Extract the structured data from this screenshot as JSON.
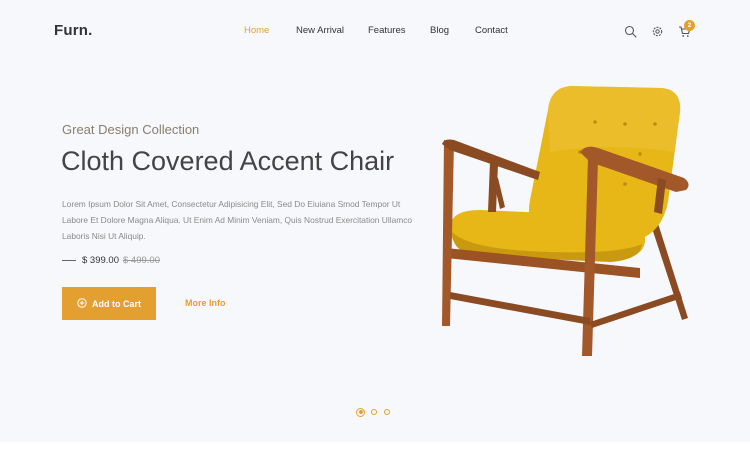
{
  "brand": {
    "logo": "Furn."
  },
  "nav": {
    "items": [
      {
        "label": "Home",
        "active": true
      },
      {
        "label": "New Arrival",
        "active": false
      },
      {
        "label": "Features",
        "active": false
      },
      {
        "label": "Blog",
        "active": false
      },
      {
        "label": "Contact",
        "active": false
      }
    ]
  },
  "header_icons": [
    "search-icon",
    "gear-icon",
    "cart-icon"
  ],
  "cart": {
    "count": "2"
  },
  "hero": {
    "subtitle": "Great Design Collection",
    "title": "Cloth Covered Accent Chair",
    "description": "Lorem Ipsum Dolor Sit Amet, Consectetur Adipisicing Elit, Sed Do Eiuiana Smod Tempor Ut Labore Et Dolore Magna Aliqua. Ut Enim Ad Minim Veniam, Quis Nostrud Exercitation Ullamco Laboris Nisi Ut Aliquip.",
    "price": "$ 399.00",
    "old_price": "$ 499.00",
    "add_to_cart_label": "Add to Cart",
    "more_info_label": "More Info"
  },
  "slider": {
    "dots": 3,
    "active_index": 0
  },
  "colors": {
    "accent": "#e3a030",
    "background": "#f7f8fb",
    "text": "#333333"
  }
}
